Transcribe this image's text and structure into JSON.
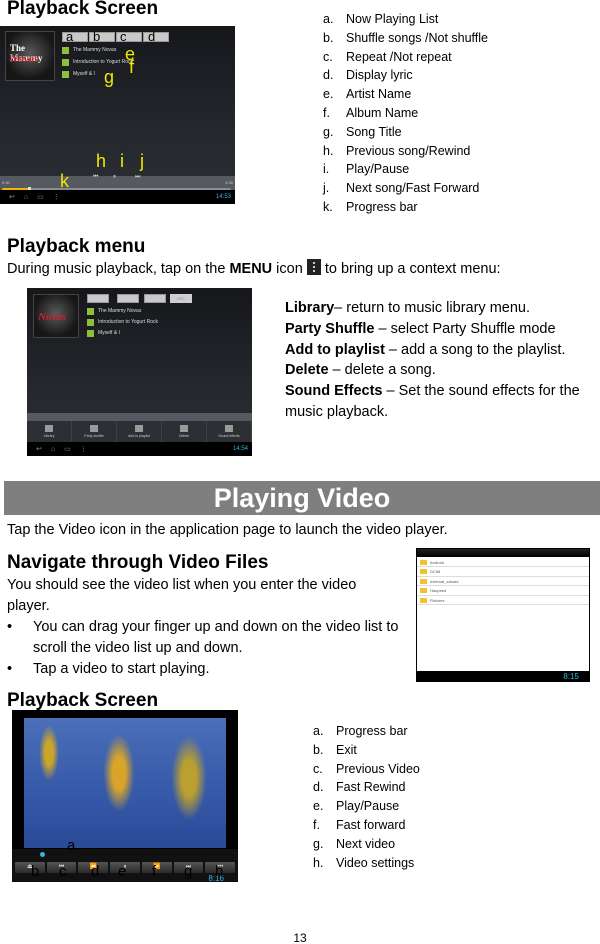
{
  "section_music_playback": {
    "heading": "Playback Screen",
    "screenshot": {
      "album_cover_line1": "The Mammy",
      "album_cover_line2": "Novas",
      "artist": "The Mammy Novas",
      "album": "Introduction to Yogurt Rock",
      "song": "Myself & I",
      "time_elapsed": "0:30",
      "time_total": "4:30",
      "progress_fraction": 0.12,
      "clock": "14:53",
      "callouts": [
        "a",
        "b",
        "c",
        "d",
        "e",
        "f",
        "g",
        "h",
        "i",
        "j",
        "k"
      ]
    },
    "legend": [
      {
        "letter": "a.",
        "text": "Now Playing List"
      },
      {
        "letter": "b.",
        "text": "Shuffle songs /Not shuffle"
      },
      {
        "letter": "c.",
        "text": "Repeat /Not repeat"
      },
      {
        "letter": "d.",
        "text": "Display lyric"
      },
      {
        "letter": "e.",
        "text": "Artist Name"
      },
      {
        "letter": "f.",
        "text": "Album Name"
      },
      {
        "letter": "g.",
        "text": "Song Title"
      },
      {
        "letter": "h.",
        "text": "Previous song/Rewind"
      },
      {
        "letter": "i.",
        "text": "Play/Pause"
      },
      {
        "letter": "j.",
        "text": "Next song/Fast Forward"
      },
      {
        "letter": "k.",
        "text": "Progress bar"
      }
    ]
  },
  "section_playback_menu": {
    "heading": "Playback menu",
    "intro_before": "During music playback, tap on the ",
    "intro_bold": "MENU",
    "intro_middle": " icon ",
    "intro_after": " to bring up a context menu:",
    "screenshot": {
      "lrc_label": "LRC",
      "artist": "The Mammy Novas",
      "album": "Introduction to Yogurt Rock",
      "song": "Myself & I",
      "clock": "14:54",
      "menu_items": [
        "Library",
        "Party shuffle",
        "Add to playlist",
        "Delete",
        "Sound effects"
      ]
    },
    "descriptions": [
      {
        "term": "Library",
        "sep": "– ",
        "desc": "return to music library menu."
      },
      {
        "term": "Party Shuffle",
        "sep": " – ",
        "desc": "select Party Shuffle mode"
      },
      {
        "term": "Add to playlist",
        "sep": " – ",
        "desc": "add a song to the playlist."
      },
      {
        "term": "Delete",
        "sep": " – ",
        "desc": "delete a song."
      },
      {
        "term": "Sound Effects",
        "sep": " – ",
        "desc": "Set the sound effects for the music playback."
      }
    ]
  },
  "banner": {
    "title": "Playing Video"
  },
  "section_video_intro": {
    "text": "Tap the Video icon in the application page to launch the video player."
  },
  "section_navigate_video": {
    "heading": "Navigate through Video Files",
    "paragraph": "You should see the video list when you enter the video player.",
    "bullets": [
      "You can drag your finger up and down on the video list to scroll the video list up and down.",
      "Tap a video to start playing."
    ],
    "screenshot": {
      "folders": [
        "Android",
        "DCIM",
        "external_sdcard",
        "Haopeed",
        "Pictures"
      ],
      "clock": "8:15"
    }
  },
  "section_video_playback": {
    "heading": "Playback Screen",
    "screenshot": {
      "clock": "8:16",
      "callouts": [
        "a",
        "b",
        "c",
        "d",
        "e",
        "f",
        "g",
        "h"
      ]
    },
    "legend": [
      {
        "letter": "a.",
        "text": "Progress bar"
      },
      {
        "letter": "b.",
        "text": "Exit"
      },
      {
        "letter": "c.",
        "text": "Previous Video"
      },
      {
        "letter": "d.",
        "text": "Fast Rewind"
      },
      {
        "letter": "e.",
        "text": "Play/Pause"
      },
      {
        "letter": "f.",
        "text": "Fast forward"
      },
      {
        "letter": "g.",
        "text": "Next video"
      },
      {
        "letter": "h.",
        "text": "Video settings"
      }
    ]
  },
  "page_number": "13"
}
